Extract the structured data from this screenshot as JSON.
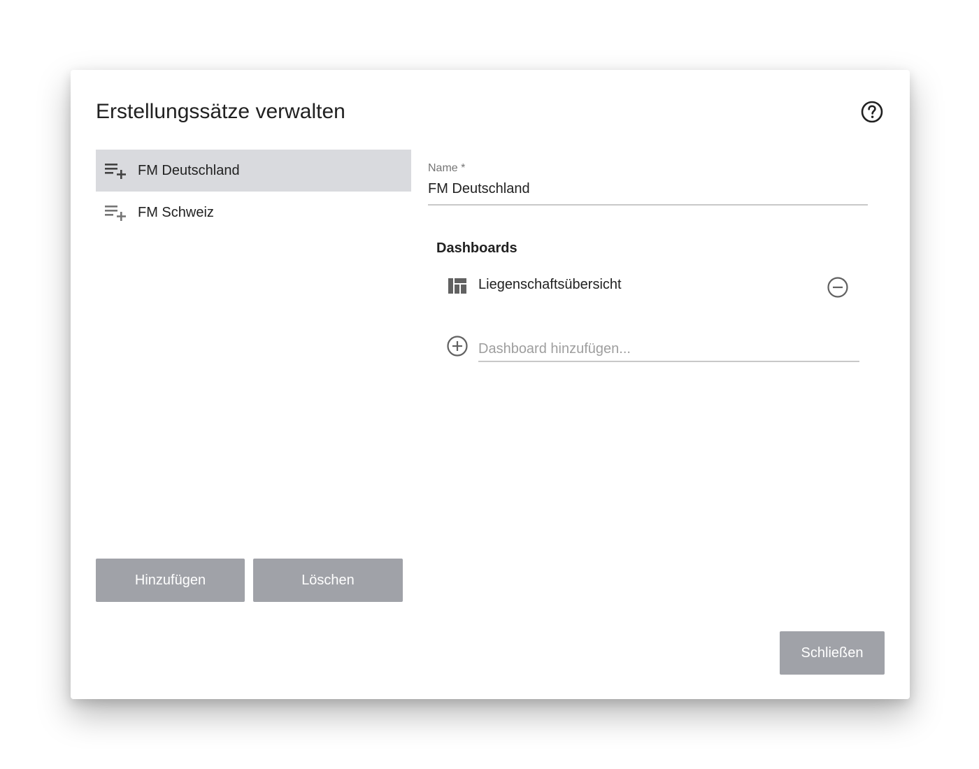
{
  "dialog": {
    "title": "Erstellungssätze verwalten",
    "help_icon": "help-circle-icon"
  },
  "sets": {
    "items": [
      {
        "label": "FM Deutschland",
        "icon": "playlist-add-icon",
        "selected": true
      },
      {
        "label": "FM Schweiz",
        "icon": "playlist-add-icon",
        "selected": false
      }
    ],
    "add_label": "Hinzufügen",
    "delete_label": "Löschen"
  },
  "editor": {
    "name_label": "Name *",
    "name_value": "FM Deutschland",
    "dashboards_heading": "Dashboards",
    "dashboards": [
      {
        "label": "Liegenschaftsübersicht",
        "icon": "dashboard-icon",
        "action_icon": "remove-circle-icon"
      }
    ],
    "add_dashboard_icon": "add-circle-icon",
    "add_dashboard_placeholder": "Dashboard hinzufügen..."
  },
  "footer": {
    "close_label": "Schließen"
  },
  "colors": {
    "button_bg": "#a0a2a8",
    "selected_bg": "#d9dade",
    "icon_gray": "#616161"
  }
}
